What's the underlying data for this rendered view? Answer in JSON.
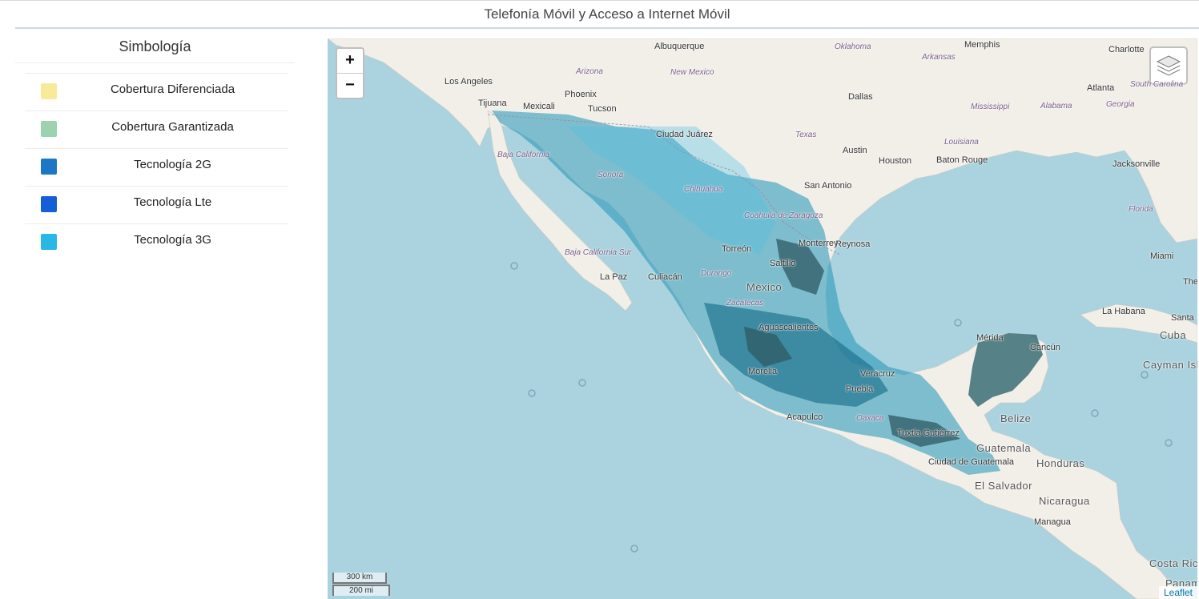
{
  "page": {
    "title": "Telefonía Móvil y Acceso a Internet Móvil"
  },
  "legend": {
    "title": "Simbología",
    "items": [
      {
        "label": "Cobertura Diferenciada",
        "color": "#f7eb99"
      },
      {
        "label": "Cobertura Garantizada",
        "color": "#9ed1ad"
      },
      {
        "label": "Tecnología 2G",
        "color": "#1c78c5"
      },
      {
        "label": "Tecnología Lte",
        "color": "#145ed8"
      },
      {
        "label": "Tecnología 3G",
        "color": "#29b8e5"
      }
    ]
  },
  "map": {
    "zoom_in": "+",
    "zoom_out": "−",
    "scale_km": "300 km",
    "scale_mi": "200 mi",
    "attribution": "Leaflet",
    "colors": {
      "water": "#aad3df",
      "land": "#f2efe9",
      "coverage_dark": "#2f5961"
    },
    "labels": [
      {
        "text": "Albuquerque",
        "kind": "city"
      },
      {
        "text": "Memphis",
        "kind": "city"
      },
      {
        "text": "Charlotte",
        "kind": "city"
      },
      {
        "text": "Oklahoma",
        "kind": "state"
      },
      {
        "text": "Arkansas",
        "kind": "state"
      },
      {
        "text": "Los Angeles",
        "kind": "city"
      },
      {
        "text": "Arizona",
        "kind": "state"
      },
      {
        "text": "New Mexico",
        "kind": "state"
      },
      {
        "text": "Phoenix",
        "kind": "city"
      },
      {
        "text": "Dallas",
        "kind": "city"
      },
      {
        "text": "Atlanta",
        "kind": "city"
      },
      {
        "text": "South Carolina",
        "kind": "state"
      },
      {
        "text": "Tijuana",
        "kind": "city"
      },
      {
        "text": "Mexicali",
        "kind": "city"
      },
      {
        "text": "Tucson",
        "kind": "city"
      },
      {
        "text": "Mississippi",
        "kind": "state"
      },
      {
        "text": "Alabama",
        "kind": "state"
      },
      {
        "text": "Georgia",
        "kind": "state"
      },
      {
        "text": "Ciudad Juárez",
        "kind": "city"
      },
      {
        "text": "Texas",
        "kind": "state"
      },
      {
        "text": "Louisiana",
        "kind": "state"
      },
      {
        "text": "Austin",
        "kind": "city"
      },
      {
        "text": "Baja California",
        "kind": "state"
      },
      {
        "text": "Houston",
        "kind": "city"
      },
      {
        "text": "Baton Rouge",
        "kind": "city"
      },
      {
        "text": "Jacksonville",
        "kind": "city"
      },
      {
        "text": "Sonora",
        "kind": "state"
      },
      {
        "text": "San Antonio",
        "kind": "city"
      },
      {
        "text": "Chihuahua",
        "kind": "state"
      },
      {
        "text": "Florida",
        "kind": "state"
      },
      {
        "text": "Coahuila de Zaragoza",
        "kind": "state"
      },
      {
        "text": "Reynosa",
        "kind": "city"
      },
      {
        "text": "Torreón",
        "kind": "city"
      },
      {
        "text": "Monterrey",
        "kind": "city"
      },
      {
        "text": "Saltillo",
        "kind": "city"
      },
      {
        "text": "Baja California Sur",
        "kind": "state"
      },
      {
        "text": "Miami",
        "kind": "city"
      },
      {
        "text": "La Paz",
        "kind": "city"
      },
      {
        "text": "Culiacán",
        "kind": "city"
      },
      {
        "text": "Durango",
        "kind": "state"
      },
      {
        "text": "México",
        "kind": "country"
      },
      {
        "text": "Zacatecas",
        "kind": "state"
      },
      {
        "text": "La Habana",
        "kind": "city"
      },
      {
        "text": "Santa",
        "kind": "city"
      },
      {
        "text": "Cuba",
        "kind": "country"
      },
      {
        "text": "Mérida",
        "kind": "city"
      },
      {
        "text": "Cancún",
        "kind": "city"
      },
      {
        "text": "Aguascalientes",
        "kind": "city"
      },
      {
        "text": "Cayman Islands",
        "kind": "country"
      },
      {
        "text": "Morelia",
        "kind": "city"
      },
      {
        "text": "Veracruz",
        "kind": "city"
      },
      {
        "text": "Puebla",
        "kind": "city"
      },
      {
        "text": "Belize",
        "kind": "country"
      },
      {
        "text": "Acapulco",
        "kind": "city"
      },
      {
        "text": "Oaxaca",
        "kind": "state"
      },
      {
        "text": "Tuxtla Gutiérrez",
        "kind": "city"
      },
      {
        "text": "Guatemala",
        "kind": "country"
      },
      {
        "text": "Ciudad de Guatemala",
        "kind": "city"
      },
      {
        "text": "Honduras",
        "kind": "country"
      },
      {
        "text": "El Salvador",
        "kind": "country"
      },
      {
        "text": "Nicaragua",
        "kind": "country"
      },
      {
        "text": "Managua",
        "kind": "city"
      },
      {
        "text": "Costa Rica",
        "kind": "country"
      },
      {
        "text": "Panamá",
        "kind": "country"
      },
      {
        "text": "The",
        "kind": "city"
      }
    ]
  }
}
